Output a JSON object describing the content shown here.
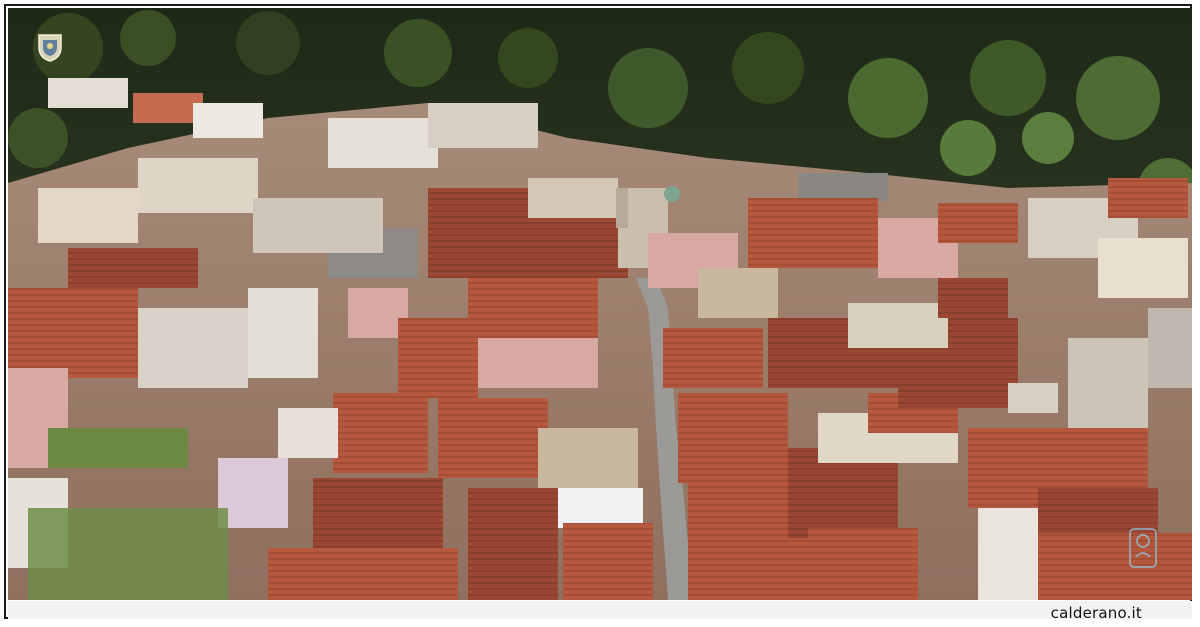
{
  "credit": "calderano.it",
  "image": {
    "scene": "aerial-village",
    "colors": {
      "roof": "#b5583e",
      "roof_dark": "#8e3f2c",
      "wall": "#d9cfc2",
      "wall_pink": "#d8a9a2",
      "forest": "#2e3a22",
      "forest_light": "#4d6b33",
      "street": "#9c9a97",
      "frame": "#1a1a1a"
    }
  }
}
